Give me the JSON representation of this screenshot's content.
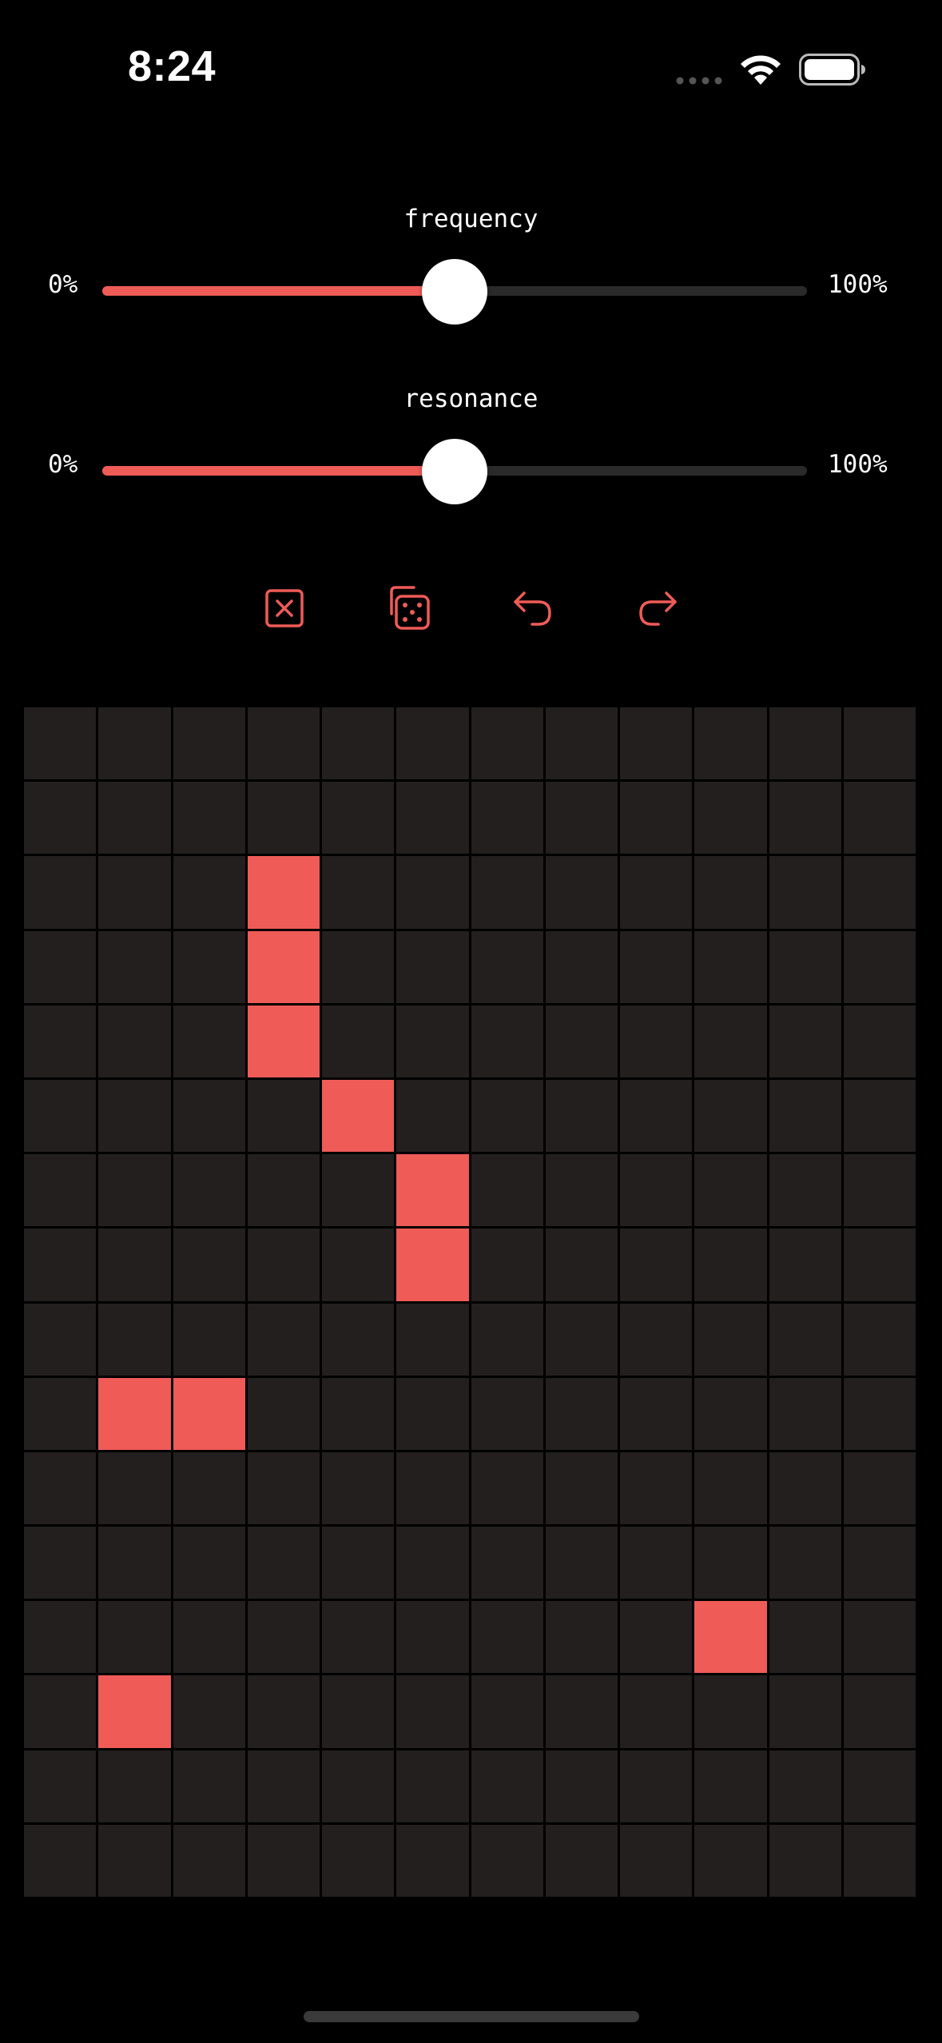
{
  "status_bar": {
    "time": "8:24",
    "signal_icon": "cellular-signal-icon",
    "wifi_icon": "wifi-icon",
    "battery_icon": "battery-icon"
  },
  "sliders": [
    {
      "label": "frequency",
      "min_label": "0%",
      "max_label": "100%",
      "value_fraction": 0.5
    },
    {
      "label": "resonance",
      "min_label": "0%",
      "max_label": "100%",
      "value_fraction": 0.5
    }
  ],
  "toolbar": {
    "buttons": [
      {
        "icon": "clear-icon"
      },
      {
        "icon": "randomize-dice-icon"
      },
      {
        "icon": "undo-icon"
      },
      {
        "icon": "redo-icon"
      }
    ]
  },
  "grid": {
    "columns": 12,
    "rows": 16,
    "active_cells": [
      [
        2,
        3
      ],
      [
        3,
        3
      ],
      [
        4,
        3
      ],
      [
        5,
        4
      ],
      [
        6,
        5
      ],
      [
        7,
        5
      ],
      [
        9,
        1
      ],
      [
        9,
        2
      ],
      [
        12,
        9
      ],
      [
        13,
        1
      ]
    ]
  },
  "colors": {
    "accent": "#ef5b57",
    "background": "#000000",
    "cell_off": "#231f1f",
    "track": "#2a2a2a",
    "thumb": "#ffffff"
  }
}
